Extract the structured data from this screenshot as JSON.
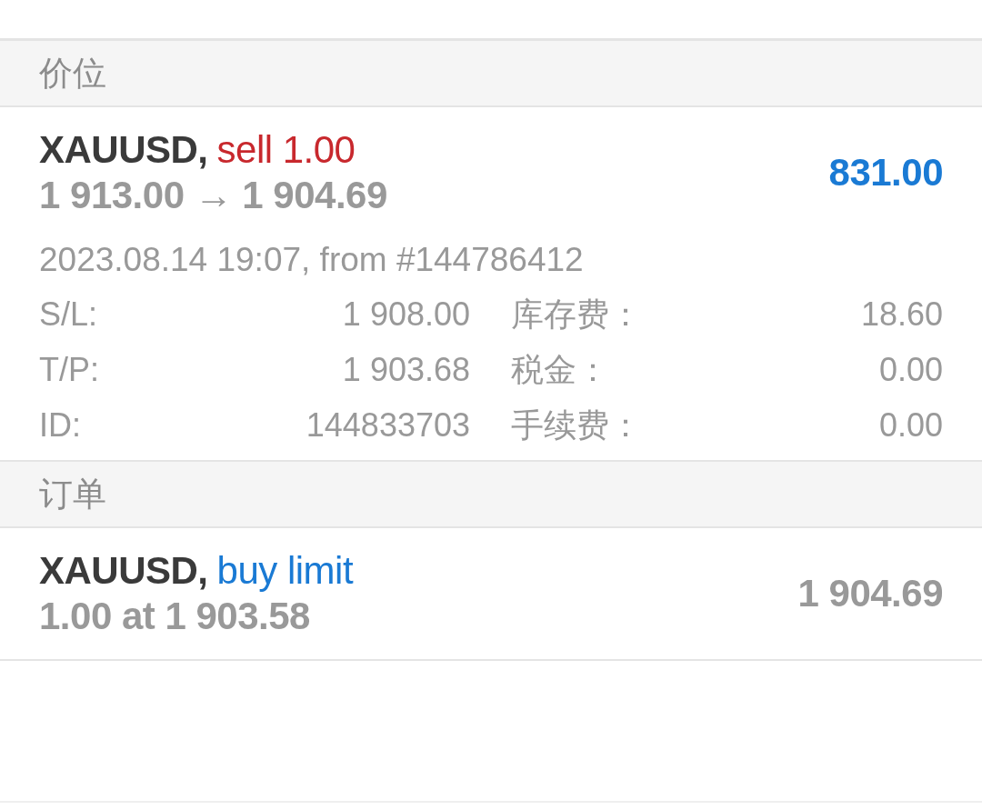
{
  "sections": [
    {
      "title": "价位",
      "items": [
        {
          "kind": "position",
          "symbol": "XAUUSD,",
          "type": "sell 1.00",
          "sell": true,
          "prices": "1 913.00 → 1 904.69",
          "amount": "831.00",
          "in_profit": true,
          "opened": "2023.08.14 19:07, from #144786412",
          "details": [
            {
              "label": "S/L:",
              "value": "1 908.00"
            },
            {
              "label": "库存费：",
              "value": "18.60"
            },
            {
              "label": "T/P:",
              "value": "1 903.68"
            },
            {
              "label": "税金：",
              "value": "0.00"
            },
            {
              "label": "ID:",
              "value": "144833703"
            },
            {
              "label": "手续费：",
              "value": "0.00"
            }
          ]
        }
      ]
    },
    {
      "title": "订单",
      "items": [
        {
          "kind": "order",
          "symbol": "XAUUSD,",
          "type": "buy limit",
          "sell": false,
          "prices": "1.00 at 1 903.58",
          "amount": "1 904.69"
        }
      ]
    }
  ]
}
